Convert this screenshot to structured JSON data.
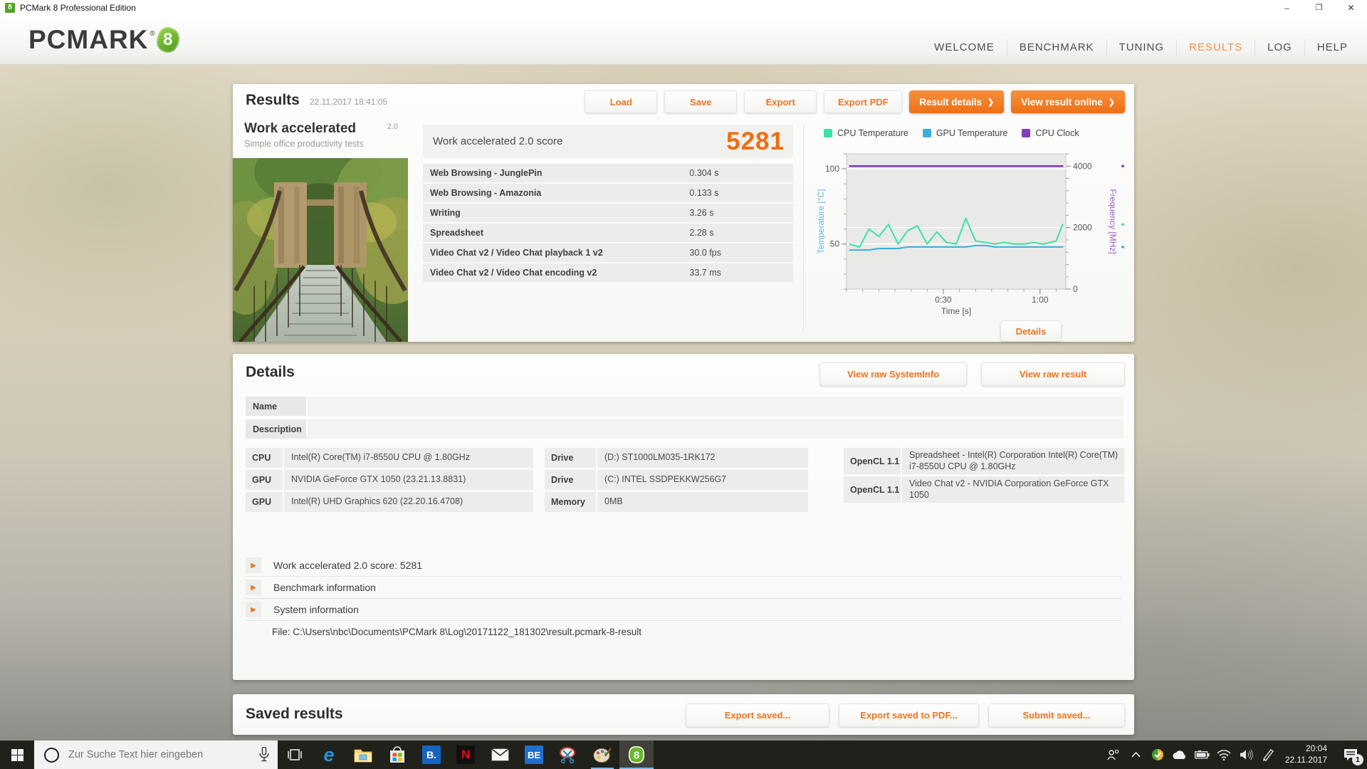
{
  "window": {
    "title": "PCMark 8 Professional Edition",
    "controls": {
      "minimize": "–",
      "restore": "❐",
      "close": "✕"
    }
  },
  "logo": {
    "word": "PCMARK",
    "reg": "®",
    "badge": "8"
  },
  "nav": {
    "items": [
      "WELCOME",
      "BENCHMARK",
      "TUNING",
      "RESULTS",
      "LOG",
      "HELP"
    ],
    "active": "RESULTS"
  },
  "results_panel": {
    "title": "Results",
    "timestamp": "22.11.2017 18:41:05",
    "buttons": {
      "load": "Load",
      "save": "Save",
      "export": "Export",
      "export_pdf": "Export PDF"
    },
    "primary_buttons": {
      "result_details": "Result details",
      "view_online": "View result online",
      "chevron": "❯"
    },
    "test": {
      "name": "Work accelerated",
      "version": "2.0",
      "subtitle": "Simple office productivity tests"
    },
    "score": {
      "label": "Work accelerated 2.0 score",
      "value": "5281"
    },
    "metrics": [
      {
        "label": "Web Browsing - JunglePin",
        "value": "0.304 s"
      },
      {
        "label": "Web Browsing - Amazonia",
        "value": "0.133 s"
      },
      {
        "label": "Writing",
        "value": "3.26 s"
      },
      {
        "label": "Spreadsheet",
        "value": "2.28 s"
      },
      {
        "label": "Video Chat v2 / Video Chat playback 1 v2",
        "value": "30.0 fps"
      },
      {
        "label": "Video Chat v2 / Video Chat encoding v2",
        "value": "33.7 ms"
      }
    ],
    "details_button": "Details"
  },
  "chart_data": {
    "type": "line",
    "xlabel": "Time [s]",
    "ylabel_left": "Temperature [°C]",
    "ylabel_right": "Frequency [MHz]",
    "xlim": [
      0,
      68
    ],
    "ylim_left": [
      20,
      110
    ],
    "ylim_right": [
      0,
      4400
    ],
    "xticks": [
      {
        "t": 30,
        "label": "0:30"
      },
      {
        "t": 60,
        "label": "1:00"
      }
    ],
    "yticks_left": [
      50,
      100
    ],
    "yticks_right": [
      0,
      2000,
      4000
    ],
    "grid": true,
    "legend_position": "top",
    "x": [
      1,
      4,
      7,
      10,
      13,
      16,
      19,
      22,
      25,
      28,
      31,
      34,
      37,
      40,
      43,
      46,
      49,
      52,
      55,
      58,
      61,
      63,
      65,
      67
    ],
    "series": [
      {
        "name": "CPU Temperature",
        "axis": "left",
        "color": "#38e2a8",
        "values": [
          50,
          48,
          60,
          55,
          63,
          50,
          59,
          62,
          50,
          58,
          51,
          50,
          67,
          52,
          51,
          50,
          51,
          50,
          50,
          51,
          50,
          51,
          52,
          63
        ]
      },
      {
        "name": "GPU Temperature",
        "axis": "left",
        "color": "#3aaede",
        "values": [
          46,
          46,
          46,
          47,
          47,
          47,
          48,
          48,
          48,
          48,
          48,
          48,
          48,
          49,
          49,
          48,
          48,
          48,
          48,
          48,
          48,
          48,
          48,
          48
        ]
      },
      {
        "name": "CPU Clock",
        "axis": "right",
        "color": "#7e3fb8",
        "values": [
          4000,
          4000,
          4000,
          4000,
          4000,
          4000,
          4000,
          4000,
          4000,
          4000,
          4000,
          4000,
          4000,
          4000,
          4000,
          4000,
          4000,
          4000,
          4000,
          4000,
          4000,
          4000,
          4000,
          4000
        ]
      }
    ]
  },
  "details_panel": {
    "title": "Details",
    "buttons": {
      "raw_systeminfo": "View raw SystemInfo",
      "raw_result": "View raw result"
    },
    "fields": [
      {
        "label": "Name",
        "value": ""
      },
      {
        "label": "Description",
        "value": ""
      }
    ],
    "specs": {
      "col1": [
        {
          "label": "CPU",
          "value": "Intel(R) Core(TM) i7-8550U CPU @ 1.80GHz"
        },
        {
          "label": "GPU",
          "value": "NVIDIA GeForce GTX 1050 (23.21.13.8831)"
        },
        {
          "label": "GPU",
          "value": "Intel(R) UHD Graphics 620 (22.20.16.4708)"
        }
      ],
      "col2": [
        {
          "label": "Drive",
          "value": "(D:) ST1000LM035-1RK172"
        },
        {
          "label": "Drive",
          "value": "(C:) INTEL SSDPEKKW256G7"
        },
        {
          "label": "Memory",
          "value": "0MB"
        }
      ],
      "col3": [
        {
          "label": "OpenCL 1.1",
          "value": "Spreadsheet - Intel(R) Corporation Intel(R) Core(TM) i7-8550U CPU @ 1.80GHz"
        },
        {
          "label": "OpenCL 1.1",
          "value": "Video Chat v2 - NVIDIA Corporation GeForce GTX 1050"
        }
      ]
    },
    "sections": [
      {
        "arrow": "▶",
        "text": "Work accelerated 2.0 score: 5281"
      },
      {
        "arrow": "▶",
        "text": "Benchmark information"
      },
      {
        "arrow": "▶",
        "text": "System information"
      }
    ],
    "file": "File: C:\\Users\\nbc\\Documents\\PCMark 8\\Log\\20171122_181302\\result.pcmark-8-result"
  },
  "saved_panel": {
    "title": "Saved results",
    "buttons": {
      "export": "Export saved...",
      "export_pdf": "Export saved to PDF...",
      "submit": "Submit saved..."
    }
  },
  "taskbar": {
    "search_placeholder": "Zur Suche Text hier eingeben",
    "tiles": {
      "b_app": "B.",
      "netflix": "N",
      "be_app": "BE"
    },
    "clock": {
      "time": "20:04",
      "date": "22.11.2017"
    },
    "notification_count": "1"
  },
  "colors": {
    "accent_orange": "#ee7014",
    "cpu_temp": "#38e2a8",
    "gpu_temp": "#3aaede",
    "cpu_clock": "#7e3fb8"
  }
}
